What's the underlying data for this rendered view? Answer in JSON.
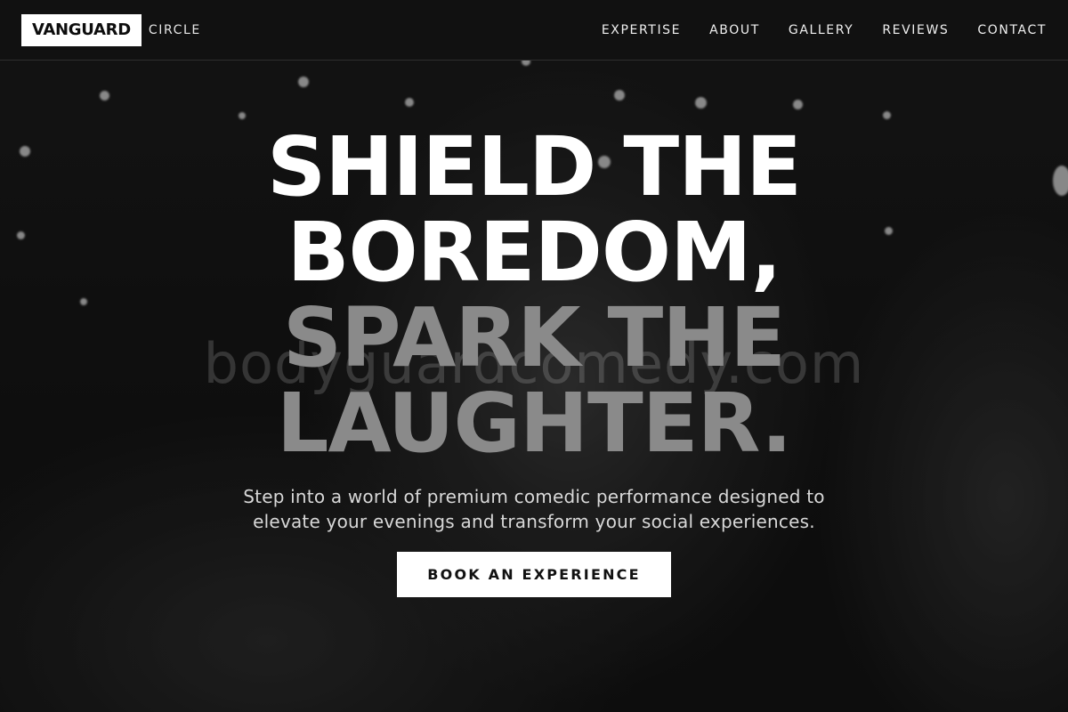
{
  "brand": {
    "name": "VANGUARD",
    "suffix": "CIRCLE"
  },
  "nav": {
    "items": [
      {
        "label": "EXPERTISE"
      },
      {
        "label": "ABOUT"
      },
      {
        "label": "GALLERY"
      },
      {
        "label": "REVIEWS"
      },
      {
        "label": "CONTACT"
      }
    ]
  },
  "hero": {
    "headline_lines": [
      "SHIELD THE",
      "BOREDOM,",
      "SPARK THE",
      "LAUGHTER."
    ],
    "subtext": "Step into a world of premium comedic performance designed to elevate your evenings and transform your social experiences.",
    "cta_label": "BOOK AN EXPERIENCE",
    "watermark": "bodyguardcomedy.com"
  },
  "colors": {
    "background": "#111111",
    "headline_primary": "#ffffff",
    "headline_accent": "#8a8a8a",
    "cta_background": "#ffffff",
    "cta_text": "#111111"
  }
}
